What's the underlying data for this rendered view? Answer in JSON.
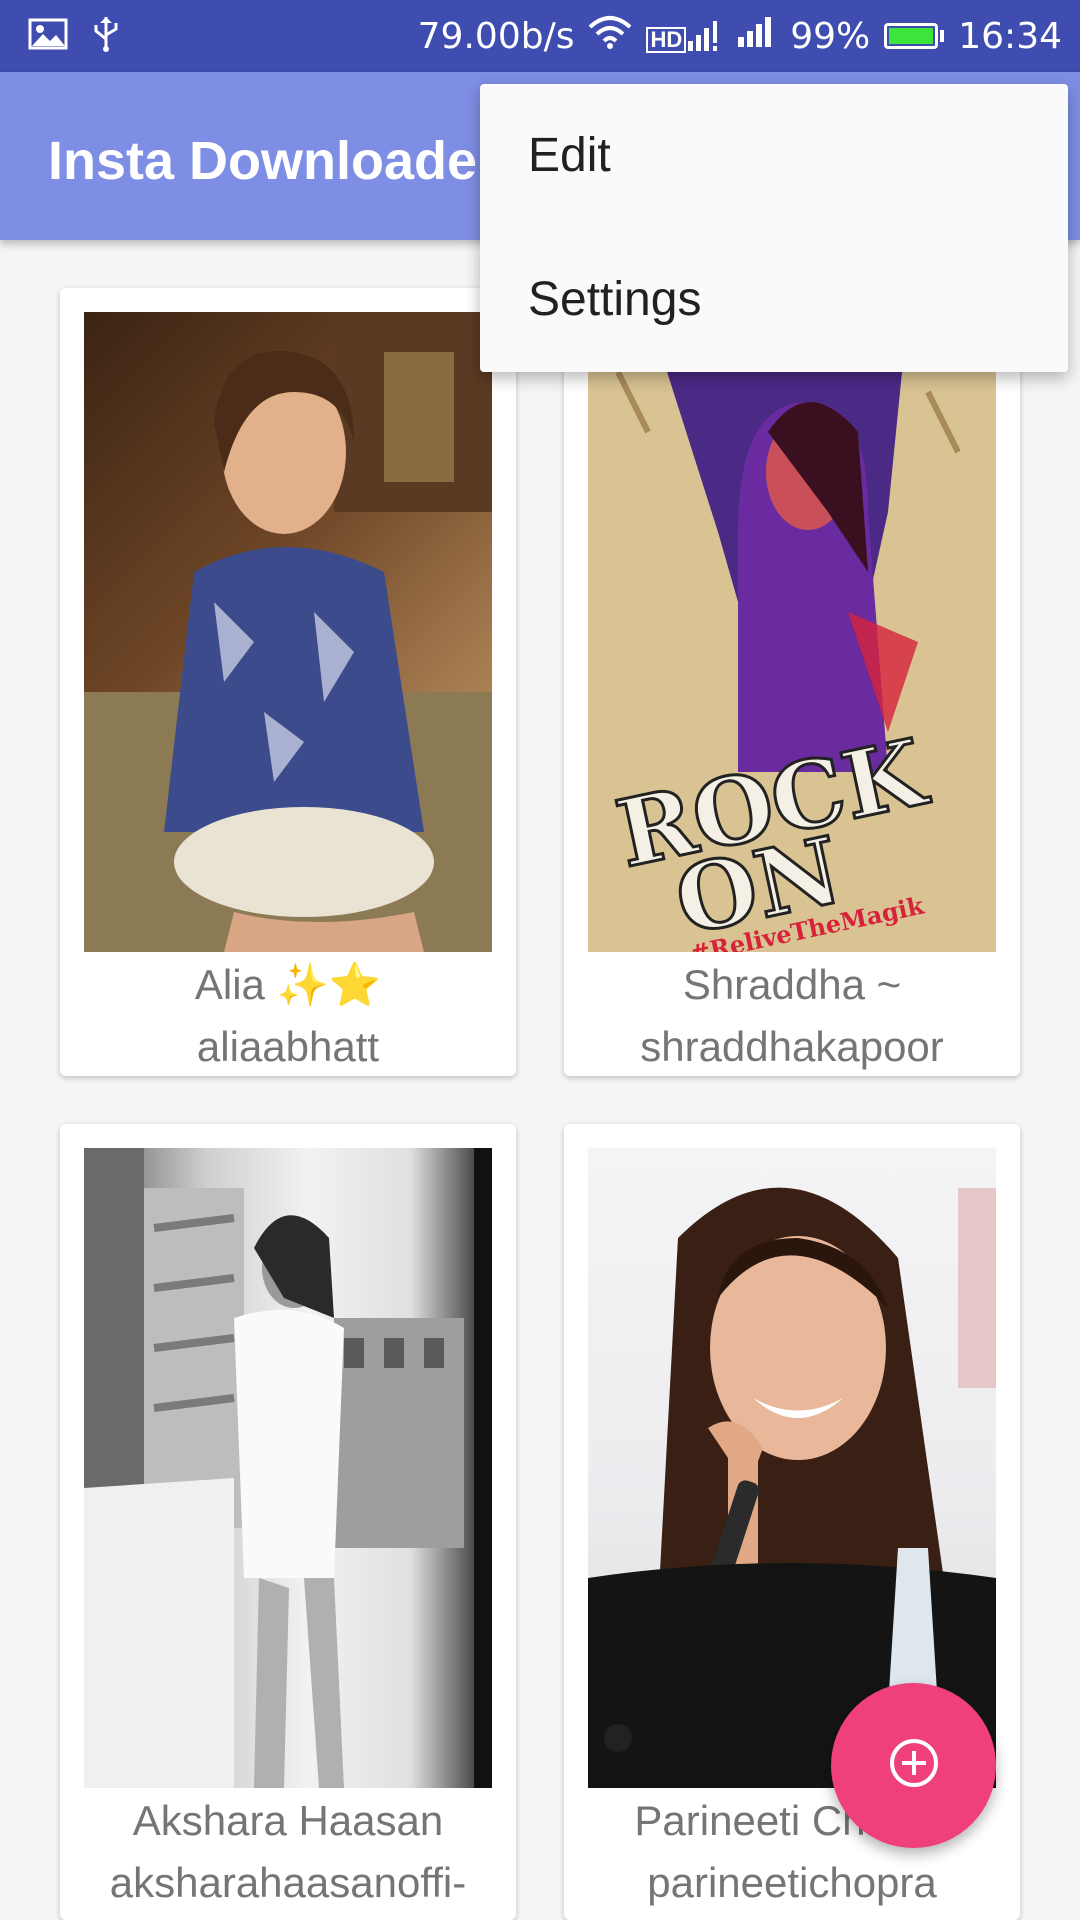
{
  "status_bar": {
    "net_speed": "79.00b/s",
    "battery": "99%",
    "time": "16:34",
    "hd_label": "HD",
    "icons": [
      "image-icon",
      "usb-icon",
      "wifi-icon",
      "hd-call-icon",
      "signal-icon",
      "signal-icon",
      "battery-icon"
    ],
    "battery_level_fraction": 0.99
  },
  "app_bar": {
    "title": "Insta Downloade",
    "color": "#7e8ee4"
  },
  "menu": {
    "items": [
      {
        "label": "Edit"
      },
      {
        "label": "Settings"
      }
    ]
  },
  "grid": {
    "cards": [
      {
        "name": "Alia ✨⭐",
        "username": "aliaabhatt"
      },
      {
        "name": "Shraddha ~",
        "username": "shraddhakapoor",
        "poster_line1": "ROCK",
        "poster_line2": "ON",
        "poster_tag": "#ReliveTheMagik"
      },
      {
        "name": "Akshara Haasan",
        "username": "aksharahaasanoffi-"
      },
      {
        "name": "Parineeti Chopra",
        "username": "parineetichopra"
      }
    ]
  },
  "fab": {
    "icon": "add-circle-icon",
    "color": "#ef3f7c"
  }
}
